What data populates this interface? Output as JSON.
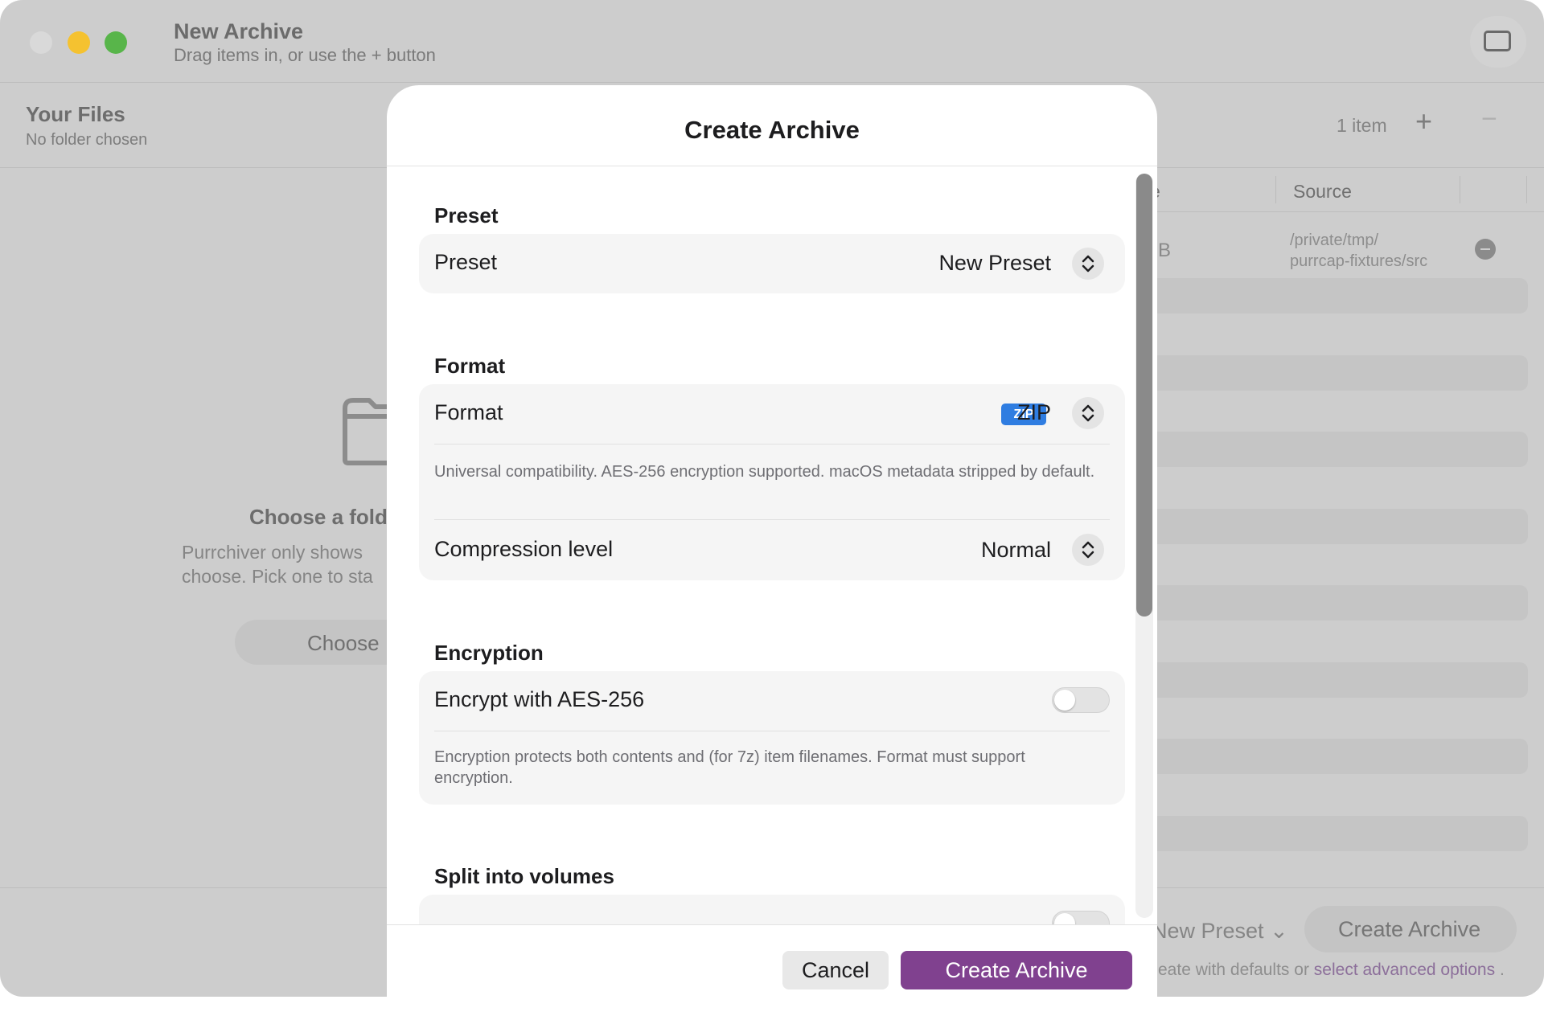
{
  "window": {
    "title": "New Archive",
    "subtitle": "Drag items in, or use the + button"
  },
  "files": {
    "title": "Your Files",
    "subtitle": "No folder chosen",
    "item_count": "1 item",
    "add_symbol": "+",
    "remove_symbol": "−"
  },
  "table": {
    "columns": [
      "e",
      "Source"
    ],
    "rows": [
      {
        "size_fragment": "B",
        "source_line1": "/private/tmp/",
        "source_line2": "purrcap-fixtures/src"
      }
    ]
  },
  "empty_state": {
    "title": "Choose a fold",
    "line1": "Purrchiver only shows",
    "line2": "choose. Pick one to sta",
    "button": "Choose"
  },
  "bottom_bar": {
    "preset": "New Preset",
    "preset_chevron": "⌄",
    "create": "Create Archive",
    "note_prefix": "eate with defaults or",
    "note_link": "select advanced options",
    "note_suffix": "."
  },
  "sheet": {
    "title": "Create Archive",
    "preset_section": {
      "heading": "Preset",
      "label": "Preset",
      "value": "New Preset"
    },
    "format_section": {
      "heading": "Format",
      "label": "Format",
      "badge": "ZIP",
      "value": "ZIP",
      "description": "Universal compatibility. AES-256 encryption supported. macOS metadata stripped by default.",
      "compression_label": "Compression level",
      "compression_value": "Normal"
    },
    "encryption_section": {
      "heading": "Encryption",
      "label": "Encrypt with AES-256",
      "enabled": false,
      "description": "Encryption protects both contents and (for 7z) item filenames. Format must support encryption."
    },
    "split_section": {
      "heading": "Split into volumes"
    },
    "cancel": "Cancel",
    "create": "Create Archive"
  },
  "colors": {
    "accent": "#80418f",
    "zip_badge": "#2f7de1",
    "traffic_min": "#f5c230",
    "traffic_max": "#58b54a"
  }
}
